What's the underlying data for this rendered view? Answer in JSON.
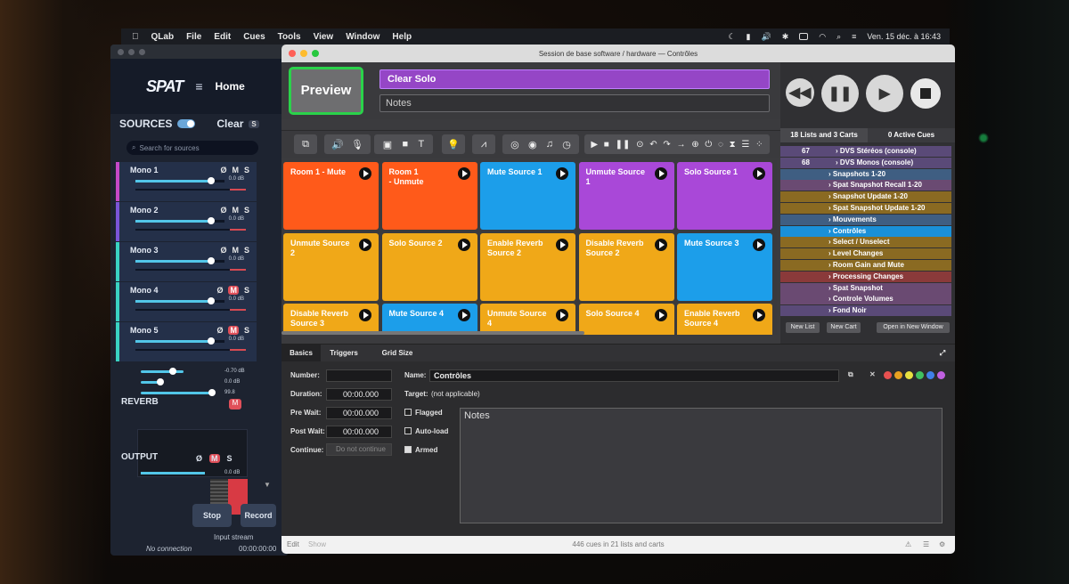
{
  "menubar": {
    "items": [
      "QLab",
      "File",
      "Edit",
      "Cues",
      "Tools",
      "View",
      "Window",
      "Help"
    ],
    "datetime": "Ven. 15 déc. à 16:43"
  },
  "spat": {
    "logo": "SPAT",
    "home": "Home",
    "sources_label": "SOURCES",
    "clear_label": "Clear",
    "clear_badge": "S",
    "search_placeholder": "Search for sources",
    "sources": [
      {
        "name": "Mono 1",
        "db": "0.0 dB",
        "color": "#c548c8",
        "mute_on": false,
        "level": 0.85
      },
      {
        "name": "Mono 2",
        "db": "0.0 dB",
        "color": "#7a55d8",
        "mute_on": false,
        "level": 0.85
      },
      {
        "name": "Mono 3",
        "db": "0.0 dB",
        "color": "#3ad2c2",
        "mute_on": false,
        "level": 0.85
      },
      {
        "name": "Mono 4",
        "db": "0.0 dB",
        "color": "#3ad2c2",
        "mute_on": true,
        "level": 0.85
      },
      {
        "name": "Mono 5",
        "db": "0.0 dB",
        "color": "#3ad2c2",
        "mute_on": true,
        "level": 0.85
      }
    ],
    "ctl_labels": {
      "phase": "Ø",
      "mute": "M",
      "solo": "S"
    },
    "reverb": {
      "label": "REVERB",
      "mute": "M",
      "values": [
        "-0.70 dB",
        "0.0 dB",
        "99.8"
      ]
    },
    "output": {
      "label": "OUTPUT",
      "db": "0.0 dB"
    },
    "stop_label": "Stop",
    "record_label": "Record",
    "input_stream": "Input stream",
    "connection": "No connection",
    "time": "00:00:00:00"
  },
  "qlab": {
    "title": "Session de base software / hardware — Contrôles",
    "preview": "Preview",
    "cue_name": "Clear Solo",
    "notes_placeholder": "Notes",
    "cart": [
      {
        "label": "Room 1 - Mute",
        "color": "#ff5a1a"
      },
      {
        "label": "Room 1\n- Unmute",
        "color": "#ff5a1a"
      },
      {
        "label": "Mute Source 1",
        "color": "#1c9eea"
      },
      {
        "label": "Unmute Source 1",
        "color": "#a948d8"
      },
      {
        "label": "Solo Source 1",
        "color": "#a948d8"
      },
      {
        "label": "Unmute Source 2",
        "color": "#f0a818"
      },
      {
        "label": "Solo Source 2",
        "color": "#f0a818"
      },
      {
        "label": "Enable Reverb Source 2",
        "color": "#f0a818"
      },
      {
        "label": "Disable Reverb Source 2",
        "color": "#f0a818"
      },
      {
        "label": "Mute Source 3",
        "color": "#1c9eea"
      },
      {
        "label": "Disable Reverb Source 3",
        "color": "#f0a818"
      },
      {
        "label": "Mute Source 4",
        "color": "#1c9eea"
      },
      {
        "label": "Unmute Source 4",
        "color": "#f0a818"
      },
      {
        "label": "Solo Source 4",
        "color": "#f0a818"
      },
      {
        "label": "Enable Reverb Source 4",
        "color": "#f0a818"
      }
    ],
    "lists_tab": "18 Lists and 3 Carts",
    "active_tab": "0 Active Cues",
    "lists": [
      {
        "num": "67",
        "label": "DVS Stéréos (console)",
        "color": "#5a4a78",
        "indent": 1
      },
      {
        "num": "68",
        "label": "DVS Monos (console)",
        "color": "#5a4a78",
        "indent": 1
      },
      {
        "num": "",
        "label": "Snapshots 1-20",
        "color": "#3f5e82",
        "indent": 0
      },
      {
        "num": "",
        "label": "Spat Snapshot Recall 1-20",
        "color": "#6a4a72",
        "indent": 0
      },
      {
        "num": "",
        "label": "Snapshot Update 1-20",
        "color": "#8a6a22",
        "indent": 0
      },
      {
        "num": "",
        "label": "Spat Snapshot Update 1-20",
        "color": "#8a6a22",
        "indent": 0
      },
      {
        "num": "",
        "label": "Mouvements",
        "color": "#3f5e82",
        "indent": 0
      },
      {
        "num": "",
        "label": "Contrôles",
        "color": "#1a90d8",
        "indent": 0
      },
      {
        "num": "",
        "label": "Select / Unselect",
        "color": "#8a6a22",
        "indent": 0
      },
      {
        "num": "",
        "label": "Level Changes",
        "color": "#8a6a22",
        "indent": 0
      },
      {
        "num": "",
        "label": "Room Gain and Mute",
        "color": "#8a6a22",
        "indent": 0
      },
      {
        "num": "",
        "label": "Processing Changes",
        "color": "#8a3a3a",
        "indent": 0
      },
      {
        "num": "",
        "label": "Spat Snapshot",
        "color": "#6a4a72",
        "indent": 0
      },
      {
        "num": "",
        "label": "Controle Volumes",
        "color": "#6a4a72",
        "indent": 0
      },
      {
        "num": "",
        "label": "Fond Noir",
        "color": "#5a4a78",
        "indent": 0
      }
    ],
    "new_list": "New List",
    "new_cart": "New Cart",
    "open_new_window": "Open in New Window",
    "tabs": [
      "Basics",
      "Triggers",
      "Grid Size"
    ],
    "inspector": {
      "number_label": "Number:",
      "number_value": "",
      "name_label": "Name:",
      "name_value": "Contrôles",
      "duration_label": "Duration:",
      "duration_value": "00:00.000",
      "target_label": "Target:",
      "target_value": "(not applicable)",
      "prewait_label": "Pre Wait:",
      "prewait_value": "00:00.000",
      "postwait_label": "Post Wait:",
      "postwait_value": "00:00.000",
      "continue_label": "Continue:",
      "continue_value": "Do not continue",
      "flagged": "Flagged",
      "autoload": "Auto-load",
      "armed": "Armed",
      "notes": "Notes",
      "colors": [
        "#e85050",
        "#e8a020",
        "#e8e040",
        "#40c060",
        "#4080e8",
        "#c060e0"
      ]
    },
    "status": {
      "edit": "Edit",
      "show": "Show",
      "summary": "446 cues in 21 lists and carts"
    }
  }
}
